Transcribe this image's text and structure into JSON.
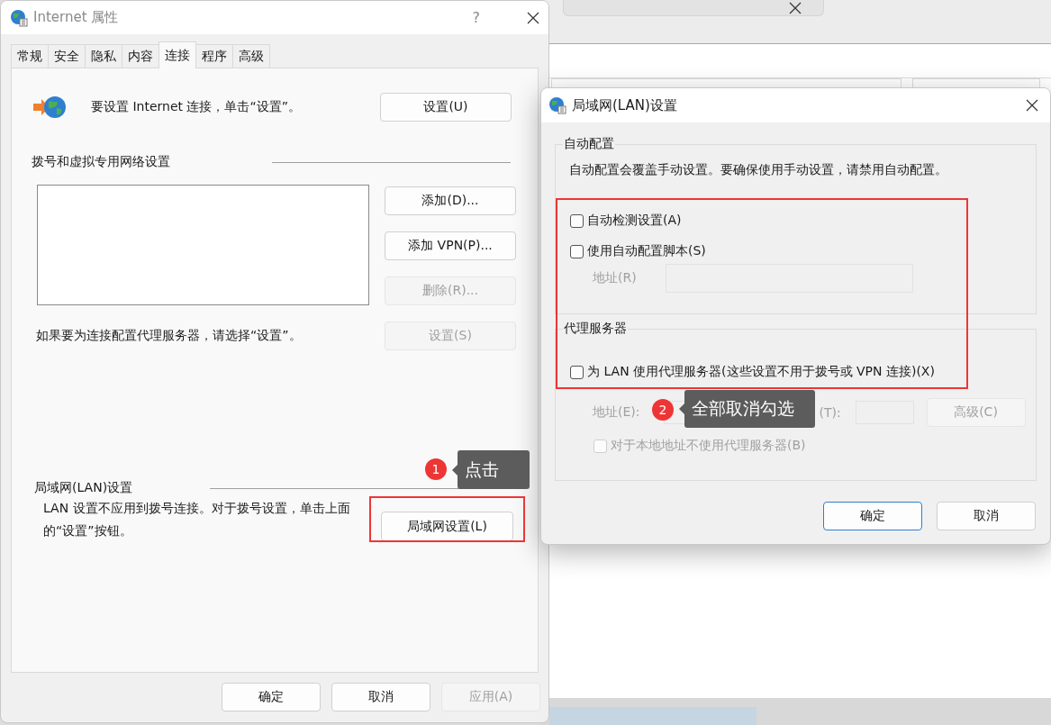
{
  "internet_properties": {
    "title": "Internet 属性",
    "help_button": "?",
    "tabs": [
      {
        "label": "常规",
        "selected": false
      },
      {
        "label": "安全",
        "selected": false
      },
      {
        "label": "隐私",
        "selected": false
      },
      {
        "label": "内容",
        "selected": false
      },
      {
        "label": "连接",
        "selected": true
      },
      {
        "label": "程序",
        "selected": false
      },
      {
        "label": "高级",
        "selected": false
      }
    ],
    "setup_text": "要设置 Internet 连接，单击“设置”。",
    "setup_button": "设置(U)",
    "dialup_heading": "拨号和虚拟专用网络设置",
    "dialup_buttons": [
      {
        "label": "添加(D)...",
        "disabled": false
      },
      {
        "label": "添加 VPN(P)...",
        "disabled": false
      },
      {
        "label": "删除(R)...",
        "disabled": true
      },
      {
        "label": "设置(S)",
        "disabled": true
      }
    ],
    "proxy_hint": "如果要为连接配置代理服务器，请选择“设置”。",
    "lan_heading": "局域网(LAN)设置",
    "lan_text": "LAN 设置不应用到拨号连接。对于拨号设置，单击上面的“设置”按钮。",
    "lan_button": "局域网设置(L)",
    "footer_buttons": [
      {
        "label": "确定",
        "disabled": false
      },
      {
        "label": "取消",
        "disabled": false
      },
      {
        "label": "应用(A)",
        "disabled": true
      }
    ]
  },
  "lan_dialog": {
    "title": "局域网(LAN)设置",
    "auto_config": {
      "heading": "自动配置",
      "description": "自动配置会覆盖手动设置。要确保使用手动设置，请禁用自动配置。",
      "options": [
        {
          "label": "自动检测设置(A)",
          "checked": false,
          "disabled": false
        },
        {
          "label": "使用自动配置脚本(S)",
          "checked": false,
          "disabled": false
        }
      ],
      "address_label": "地址(R)"
    },
    "proxy": {
      "heading": "代理服务器",
      "use_proxy": {
        "label": "为 LAN 使用代理服务器(这些设置不用于拨号或 VPN 连接)(X)",
        "checked": false,
        "disabled": false
      },
      "address_label": "地址(E):",
      "port_label": "(T):",
      "advanced_button": "高级(C)",
      "bypass_local": {
        "label": "对于本地地址不使用代理服务器(B)",
        "checked": false,
        "disabled": true
      }
    },
    "buttons": [
      {
        "label": "确定",
        "default": true
      },
      {
        "label": "取消",
        "default": false
      }
    ]
  },
  "annotations": [
    {
      "number": "1",
      "text": "点击"
    },
    {
      "number": "2",
      "text": "全部取消勾选"
    }
  ]
}
